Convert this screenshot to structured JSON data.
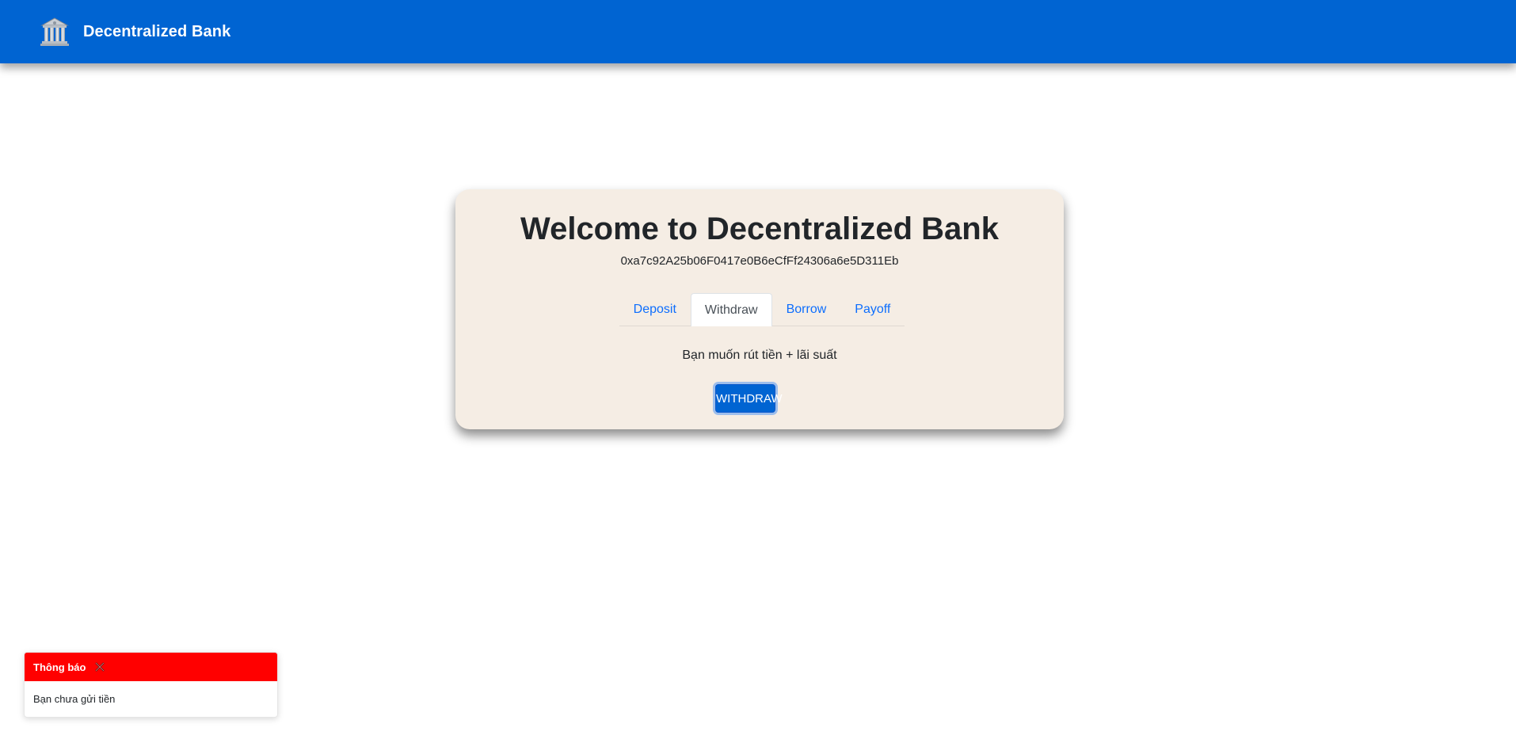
{
  "navbar": {
    "brand_title": "Decentralized Bank",
    "brand_icon": "bank-building-icon",
    "background_color": "#0064d2"
  },
  "card": {
    "title": "Welcome to Decentralized Bank",
    "account_address": "0xa7c92A25b06F0417e0B6eCfFf24306a6e5D311Eb",
    "background_color": "#f5ede4",
    "tabs": [
      {
        "label": "Deposit",
        "active": false
      },
      {
        "label": "Withdraw",
        "active": true
      },
      {
        "label": "Borrow",
        "active": false
      },
      {
        "label": "Payoff",
        "active": false
      }
    ],
    "withdraw_panel": {
      "prompt": "Bạn muốn rút tiền + lãi suất",
      "button_label": "WITHDRAW"
    }
  },
  "toast": {
    "title": "Thông báo",
    "message": "Bạn chưa gửi tiền",
    "header_color": "#ff0000",
    "close_icon": "close-icon"
  }
}
